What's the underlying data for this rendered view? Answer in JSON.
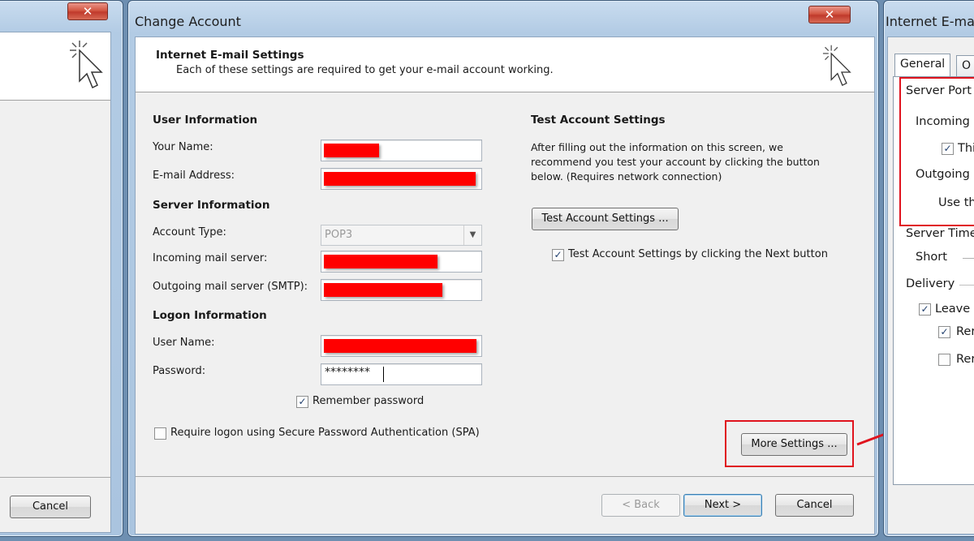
{
  "left_window": {
    "cancel_label": "Cancel"
  },
  "main_dialog": {
    "title": "Change Account",
    "close_glyph": "✕",
    "header": {
      "title": "Internet E-mail Settings",
      "subtitle": "Each of these settings are required to get your e-mail account working."
    },
    "user_info": {
      "section": "User Information",
      "name_label": "Your Name:",
      "email_label": "E-mail Address:"
    },
    "server_info": {
      "section": "Server Information",
      "account_type_label": "Account Type:",
      "account_type_value": "POP3",
      "incoming_label": "Incoming mail server:",
      "outgoing_label": "Outgoing mail server (SMTP):"
    },
    "logon_info": {
      "section": "Logon Information",
      "username_label": "User Name:",
      "password_label": "Password:",
      "password_mask": "********",
      "remember_label": "Remember password",
      "remember_checked": true,
      "spa_label": "Require logon using Secure Password Authentication (SPA)",
      "spa_checked": false
    },
    "test": {
      "section": "Test Account Settings",
      "description": "After filling out the information on this screen, we recommend you test your account by clicking the button below. (Requires network connection)",
      "button_label": "Test Account Settings ...",
      "next_check_label": "Test Account Settings by clicking the Next button",
      "next_check_checked": true
    },
    "more_settings_label": "More Settings ...",
    "footer": {
      "back_label": "< Back",
      "next_label": "Next >",
      "cancel_label": "Cancel"
    }
  },
  "right_window": {
    "title": "Internet E-ma",
    "tabs": [
      {
        "label": "General"
      },
      {
        "label": "O"
      }
    ],
    "server_port_label": "Server Port",
    "incoming_label": "Incoming",
    "this_label": "Thi",
    "outgoing_label": "Outgoing",
    "use_label": "Use th",
    "server_timeout_label": "Server Time",
    "short_label": "Short",
    "delivery_label": "Delivery",
    "leave_label": "Leave a",
    "rem1_label": "Rer",
    "rem2_label": "Rer"
  },
  "colors": {
    "highlight_red": "#e0141e",
    "redaction": "#ff0000"
  }
}
